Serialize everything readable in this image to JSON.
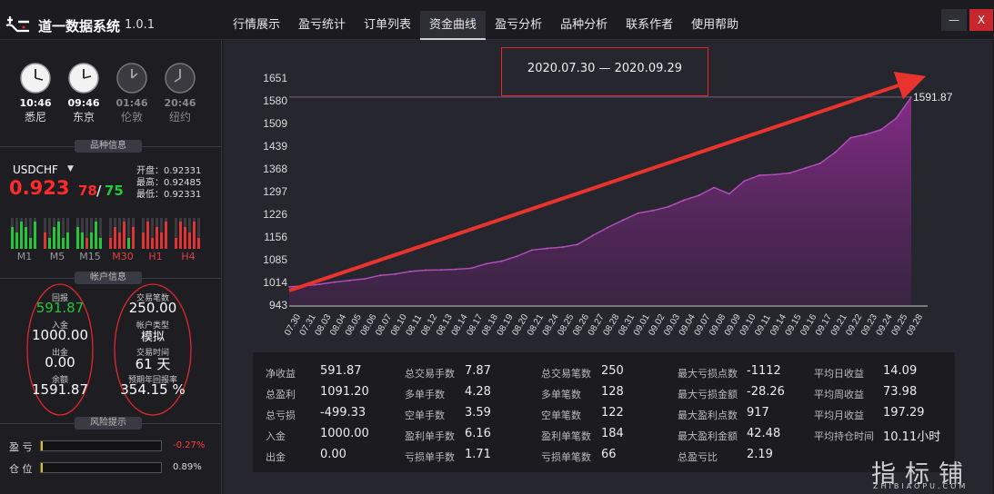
{
  "app": {
    "title": "道一数据系统",
    "version": "1.0.1"
  },
  "nav": [
    "行情展示",
    "盈亏统计",
    "订单列表",
    "资金曲线",
    "盈亏分析",
    "品种分析",
    "联系作者",
    "使用帮助"
  ],
  "nav_active": "资金曲线",
  "window": {
    "minimize": "—",
    "close": "X"
  },
  "clocks": [
    {
      "time": "10:46",
      "city": "悉尼"
    },
    {
      "time": "09:46",
      "city": "东京"
    },
    {
      "time": "01:46",
      "city": "伦敦"
    },
    {
      "time": "20:46",
      "city": "纽约"
    }
  ],
  "sections": {
    "symbol_info": "品种信息",
    "account_info": "帐户信息",
    "risk": "风险提示"
  },
  "symbol": {
    "name": "USDCHF",
    "price_main": "0.923",
    "price_78": "78",
    "price_sep": "/",
    "price_75": "75",
    "open": "开盘：0.92331",
    "high": "最高：0.92485",
    "low": "最低：0.92331",
    "timeframes": [
      "M1",
      "M5",
      "M15",
      "M30",
      "H1",
      "H4"
    ]
  },
  "account": {
    "profit_label": "回报",
    "profit": "591.87",
    "deposit_label": "入金",
    "deposit": "1000.00",
    "withdraw_label": "出金",
    "withdraw": "0.00",
    "balance_label": "余额",
    "balance": "1591.87",
    "trades_label": "交易笔数",
    "trades": "250.00",
    "type_label": "帐户类型",
    "type": "模拟",
    "time_label": "交易时间",
    "time": "61 天",
    "annual_label": "预期年回报率",
    "annual": "354.15 %"
  },
  "risk": {
    "pl_label": "盈 亏",
    "pl_value": "-0.27%",
    "pos_label": "仓 位",
    "pos_value": "0.89%"
  },
  "chart_data": {
    "type": "area",
    "title": "2020.07.30 — 2020.09.29",
    "ylim": [
      943,
      1651
    ],
    "y_ticks": [
      943,
      1014,
      1085,
      1156,
      1226,
      1297,
      1368,
      1439,
      1509,
      1580,
      1651
    ],
    "x": [
      "07.30",
      "07.31",
      "08.03",
      "08.04",
      "08.05",
      "08.06",
      "08.07",
      "08.10",
      "08.11",
      "08.12",
      "08.13",
      "08.14",
      "08.17",
      "08.18",
      "08.19",
      "08.20",
      "08.21",
      "08.24",
      "08.25",
      "08.26",
      "08.27",
      "08.28",
      "08.31",
      "09.01",
      "09.02",
      "09.03",
      "09.04",
      "09.07",
      "09.08",
      "09.09",
      "09.10",
      "09.11",
      "09.14",
      "09.15",
      "09.16",
      "09.17",
      "09.21",
      "09.22",
      "09.23",
      "09.24",
      "09.25",
      "09.28"
    ],
    "values": [
      1000,
      1003,
      1008,
      1015,
      1020,
      1025,
      1036,
      1040,
      1048,
      1052,
      1053,
      1055,
      1058,
      1072,
      1080,
      1095,
      1115,
      1120,
      1124,
      1132,
      1160,
      1185,
      1208,
      1230,
      1238,
      1250,
      1270,
      1285,
      1310,
      1290,
      1330,
      1348,
      1350,
      1355,
      1370,
      1385,
      1420,
      1465,
      1475,
      1490,
      1525,
      1591.87
    ],
    "last_label": "1591.87"
  },
  "stats": [
    [
      [
        "净收益",
        "591.87"
      ],
      [
        "总盈利",
        "1091.20"
      ],
      [
        "总亏损",
        "-499.33"
      ],
      [
        "入金",
        "1000.00"
      ],
      [
        "出金",
        "0.00"
      ]
    ],
    [
      [
        "总交易手数",
        "7.87"
      ],
      [
        "多单手数",
        "4.28"
      ],
      [
        "空单手数",
        "3.59"
      ],
      [
        "盈利单手数",
        "6.16"
      ],
      [
        "亏损单手数",
        "1.71"
      ]
    ],
    [
      [
        "总交易笔数",
        "250"
      ],
      [
        "多单笔数",
        "128"
      ],
      [
        "空单笔数",
        "122"
      ],
      [
        "盈利单笔数",
        "184"
      ],
      [
        "亏损单笔数",
        "66"
      ]
    ],
    [
      [
        "最大亏损点数",
        "-1112"
      ],
      [
        "最大亏损金额",
        "-28.26"
      ],
      [
        "最大盈利点数",
        "917"
      ],
      [
        "最大盈利金额",
        "42.48"
      ],
      [
        "总盈亏比",
        "2.19"
      ]
    ],
    [
      [
        "平均日收益",
        "14.09"
      ],
      [
        "平均周收益",
        "73.98"
      ],
      [
        "平均月收益",
        "197.29"
      ],
      [
        "平均持仓时间",
        "10.11小时"
      ]
    ]
  ],
  "watermark": {
    "text": "指标铺",
    "sub": "ZHIBIAOPU.COM"
  },
  "colors": {
    "area": "#8a2c8c",
    "arrow": "#e8342d",
    "highlight": "#e0282d",
    "price_up": "#ff2a2a",
    "price_down": "#22c83a"
  }
}
